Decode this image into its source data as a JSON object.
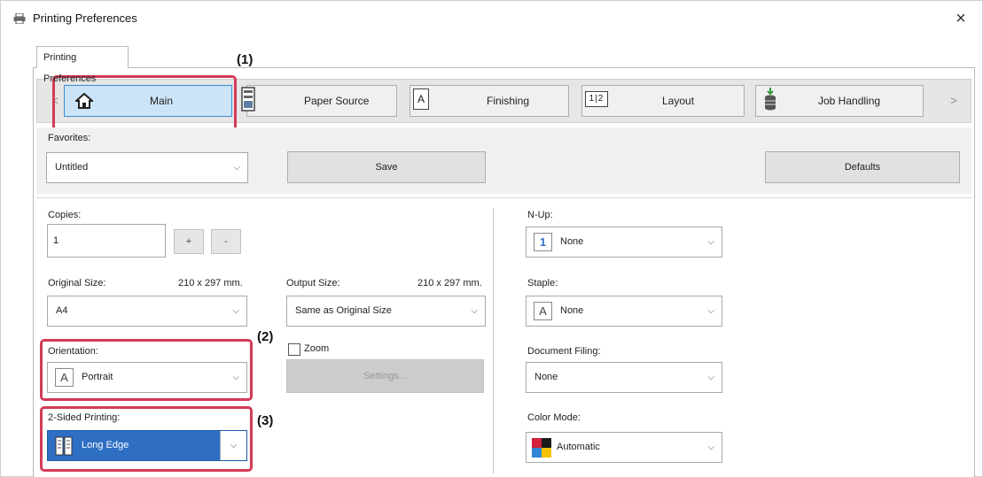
{
  "window": {
    "title": "Printing Preferences",
    "close_glyph": "×"
  },
  "outer_tab": {
    "label": "Printing Preferences"
  },
  "feature_tabs": {
    "prev_glyph": "<",
    "next_glyph": ">",
    "items": [
      {
        "label": "Main",
        "icon": "home-icon",
        "active": true
      },
      {
        "label": "Paper Source",
        "icon": "paper-tray-icon",
        "active": false
      },
      {
        "label": "Finishing",
        "icon": "finishing-icon",
        "active": false
      },
      {
        "label": "Layout",
        "icon": "layout-icon",
        "active": false
      },
      {
        "label": "Job Handling",
        "icon": "job-handling-icon",
        "active": false
      }
    ]
  },
  "annotations": {
    "step1": "(1)",
    "step2": "(2)",
    "step3": "(3)",
    "highlight_color": "#d33b57"
  },
  "favorites": {
    "label": "Favorites:",
    "value": "Untitled",
    "save_label": "Save",
    "defaults_label": "Defaults"
  },
  "copies": {
    "label": "Copies:",
    "value": "1",
    "plus": "+",
    "minus": "-"
  },
  "original_size": {
    "label": "Original Size:",
    "dimensions": "210 x 297 mm.",
    "value": "A4"
  },
  "output_size": {
    "label": "Output Size:",
    "dimensions": "210 x 297 mm.",
    "value": "Same as Original Size"
  },
  "orientation": {
    "label": "Orientation:",
    "value": "Portrait",
    "icon_glyph": "A"
  },
  "zoom": {
    "label": "Zoom",
    "checked": false,
    "settings_label": "Settings..."
  },
  "two_sided": {
    "label": "2-Sided Printing:",
    "value": "Long Edge"
  },
  "n_up": {
    "label": "N-Up:",
    "value": "None",
    "icon_glyph": "1"
  },
  "staple": {
    "label": "Staple:",
    "value": "None",
    "icon_glyph": "A"
  },
  "document_filing": {
    "label": "Document Filing:",
    "value": "None"
  },
  "color_mode": {
    "label": "Color Mode:",
    "value": "Automatic"
  },
  "chevron": "⌵",
  "colors": {
    "active_tab_bg": "#cce4f7",
    "selected_bg": "#2e6fc4"
  }
}
